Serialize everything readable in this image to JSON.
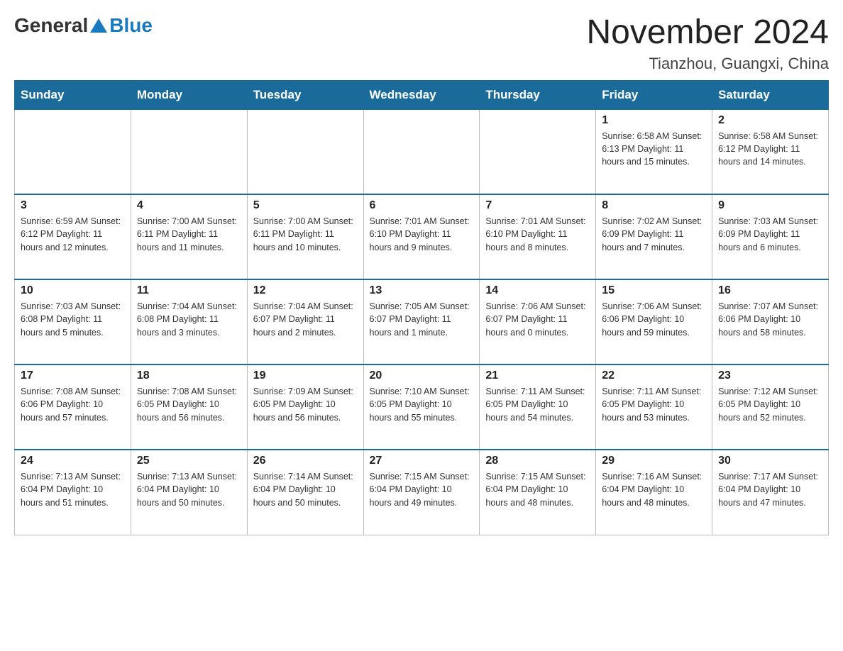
{
  "header": {
    "logo_general": "General",
    "logo_blue": "Blue",
    "month_title": "November 2024",
    "location": "Tianzhou, Guangxi, China"
  },
  "days_of_week": [
    "Sunday",
    "Monday",
    "Tuesday",
    "Wednesday",
    "Thursday",
    "Friday",
    "Saturday"
  ],
  "weeks": [
    {
      "cells": [
        {
          "day": null,
          "info": null
        },
        {
          "day": null,
          "info": null
        },
        {
          "day": null,
          "info": null
        },
        {
          "day": null,
          "info": null
        },
        {
          "day": null,
          "info": null
        },
        {
          "day": "1",
          "info": "Sunrise: 6:58 AM\nSunset: 6:13 PM\nDaylight: 11 hours and 15 minutes."
        },
        {
          "day": "2",
          "info": "Sunrise: 6:58 AM\nSunset: 6:12 PM\nDaylight: 11 hours and 14 minutes."
        }
      ]
    },
    {
      "cells": [
        {
          "day": "3",
          "info": "Sunrise: 6:59 AM\nSunset: 6:12 PM\nDaylight: 11 hours and 12 minutes."
        },
        {
          "day": "4",
          "info": "Sunrise: 7:00 AM\nSunset: 6:11 PM\nDaylight: 11 hours and 11 minutes."
        },
        {
          "day": "5",
          "info": "Sunrise: 7:00 AM\nSunset: 6:11 PM\nDaylight: 11 hours and 10 minutes."
        },
        {
          "day": "6",
          "info": "Sunrise: 7:01 AM\nSunset: 6:10 PM\nDaylight: 11 hours and 9 minutes."
        },
        {
          "day": "7",
          "info": "Sunrise: 7:01 AM\nSunset: 6:10 PM\nDaylight: 11 hours and 8 minutes."
        },
        {
          "day": "8",
          "info": "Sunrise: 7:02 AM\nSunset: 6:09 PM\nDaylight: 11 hours and 7 minutes."
        },
        {
          "day": "9",
          "info": "Sunrise: 7:03 AM\nSunset: 6:09 PM\nDaylight: 11 hours and 6 minutes."
        }
      ]
    },
    {
      "cells": [
        {
          "day": "10",
          "info": "Sunrise: 7:03 AM\nSunset: 6:08 PM\nDaylight: 11 hours and 5 minutes."
        },
        {
          "day": "11",
          "info": "Sunrise: 7:04 AM\nSunset: 6:08 PM\nDaylight: 11 hours and 3 minutes."
        },
        {
          "day": "12",
          "info": "Sunrise: 7:04 AM\nSunset: 6:07 PM\nDaylight: 11 hours and 2 minutes."
        },
        {
          "day": "13",
          "info": "Sunrise: 7:05 AM\nSunset: 6:07 PM\nDaylight: 11 hours and 1 minute."
        },
        {
          "day": "14",
          "info": "Sunrise: 7:06 AM\nSunset: 6:07 PM\nDaylight: 11 hours and 0 minutes."
        },
        {
          "day": "15",
          "info": "Sunrise: 7:06 AM\nSunset: 6:06 PM\nDaylight: 10 hours and 59 minutes."
        },
        {
          "day": "16",
          "info": "Sunrise: 7:07 AM\nSunset: 6:06 PM\nDaylight: 10 hours and 58 minutes."
        }
      ]
    },
    {
      "cells": [
        {
          "day": "17",
          "info": "Sunrise: 7:08 AM\nSunset: 6:06 PM\nDaylight: 10 hours and 57 minutes."
        },
        {
          "day": "18",
          "info": "Sunrise: 7:08 AM\nSunset: 6:05 PM\nDaylight: 10 hours and 56 minutes."
        },
        {
          "day": "19",
          "info": "Sunrise: 7:09 AM\nSunset: 6:05 PM\nDaylight: 10 hours and 56 minutes."
        },
        {
          "day": "20",
          "info": "Sunrise: 7:10 AM\nSunset: 6:05 PM\nDaylight: 10 hours and 55 minutes."
        },
        {
          "day": "21",
          "info": "Sunrise: 7:11 AM\nSunset: 6:05 PM\nDaylight: 10 hours and 54 minutes."
        },
        {
          "day": "22",
          "info": "Sunrise: 7:11 AM\nSunset: 6:05 PM\nDaylight: 10 hours and 53 minutes."
        },
        {
          "day": "23",
          "info": "Sunrise: 7:12 AM\nSunset: 6:05 PM\nDaylight: 10 hours and 52 minutes."
        }
      ]
    },
    {
      "cells": [
        {
          "day": "24",
          "info": "Sunrise: 7:13 AM\nSunset: 6:04 PM\nDaylight: 10 hours and 51 minutes."
        },
        {
          "day": "25",
          "info": "Sunrise: 7:13 AM\nSunset: 6:04 PM\nDaylight: 10 hours and 50 minutes."
        },
        {
          "day": "26",
          "info": "Sunrise: 7:14 AM\nSunset: 6:04 PM\nDaylight: 10 hours and 50 minutes."
        },
        {
          "day": "27",
          "info": "Sunrise: 7:15 AM\nSunset: 6:04 PM\nDaylight: 10 hours and 49 minutes."
        },
        {
          "day": "28",
          "info": "Sunrise: 7:15 AM\nSunset: 6:04 PM\nDaylight: 10 hours and 48 minutes."
        },
        {
          "day": "29",
          "info": "Sunrise: 7:16 AM\nSunset: 6:04 PM\nDaylight: 10 hours and 48 minutes."
        },
        {
          "day": "30",
          "info": "Sunrise: 7:17 AM\nSunset: 6:04 PM\nDaylight: 10 hours and 47 minutes."
        }
      ]
    }
  ]
}
